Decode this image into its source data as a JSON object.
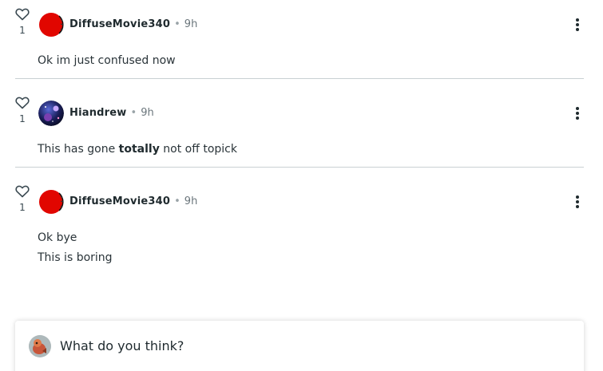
{
  "comments": [
    {
      "like_count": "1",
      "username": "DiffuseMovie340",
      "separator": "•",
      "time": "9h",
      "avatar_icon": "red-circle-avatar-icon",
      "text_lines": [
        "Ok im just confused now"
      ]
    },
    {
      "like_count": "1",
      "username": "Hiandrew",
      "separator": "•",
      "time": "9h",
      "avatar_icon": "space-planet-avatar-icon",
      "text_parts": [
        "This has gone ",
        "totally",
        " not off topick"
      ]
    },
    {
      "like_count": "1",
      "username": "DiffuseMovie340",
      "separator": "•",
      "time": "9h",
      "avatar_icon": "red-circle-avatar-icon",
      "text_lines": [
        "Ok bye",
        "This is boring"
      ]
    }
  ],
  "composer": {
    "placeholder": "What do you think?",
    "avatar_icon": "user-avatar-icon"
  },
  "colors": {
    "text": "#1f2a2e",
    "divider": "#c9d0d3",
    "avatar_red": "#e10600"
  }
}
